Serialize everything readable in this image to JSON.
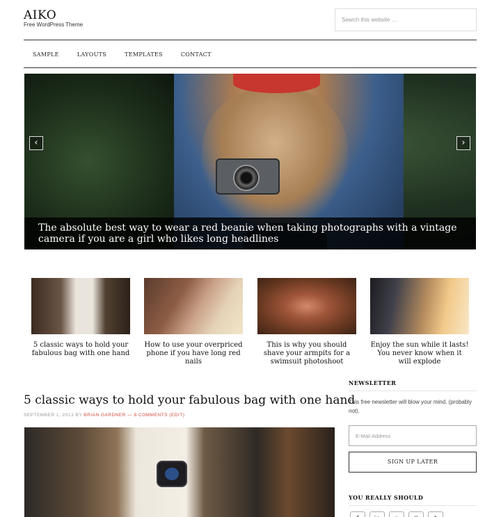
{
  "site": {
    "title": "AIKO",
    "description": "Free WordPress Theme"
  },
  "search": {
    "placeholder": "Search this website …"
  },
  "nav": {
    "items": [
      "SAMPLE",
      "LAYOUTS",
      "TEMPLATES",
      "CONTACT"
    ]
  },
  "slider": {
    "caption": "The absolute best way to wear a red beanie when taking photographs with a vintage camera if you are a girl who likes long headlines",
    "prev_label": "‹",
    "next_label": "›"
  },
  "featured": [
    {
      "caption": "5 classic ways to hold your fabulous bag with one hand"
    },
    {
      "caption": "How to use your overpriced phone if you have long red nails"
    },
    {
      "caption": "This is why you should shave your armpits for a swimsuit photoshoot"
    },
    {
      "caption": "Enjoy the sun while it lasts! You never know when it will explode"
    }
  ],
  "post": {
    "title": "5 classic ways to hold your fabulous bag with one hand",
    "date": "SEPTEMBER 1, 2013",
    "by": "BY",
    "author": "BRIAN GARDNER",
    "separator": "—",
    "comments": "8 COMMENTS (EDIT)"
  },
  "sidebar": {
    "newsletter_title": "NEWSLETTER",
    "newsletter_text": "This free newsletter will blow your mind. (probably not).",
    "email_placeholder": "E-Mail Address",
    "signup_label": "SIGN UP LATER",
    "social_title": "YOU REALLY SHOULD",
    "social_icons": [
      "facebook-icon",
      "linkedin-icon",
      "pinterest-icon",
      "instagram-icon",
      "twitter-icon"
    ]
  },
  "colors": {
    "accent": "#d04a3c",
    "text": "#222222",
    "caption_bg": "#000000"
  }
}
